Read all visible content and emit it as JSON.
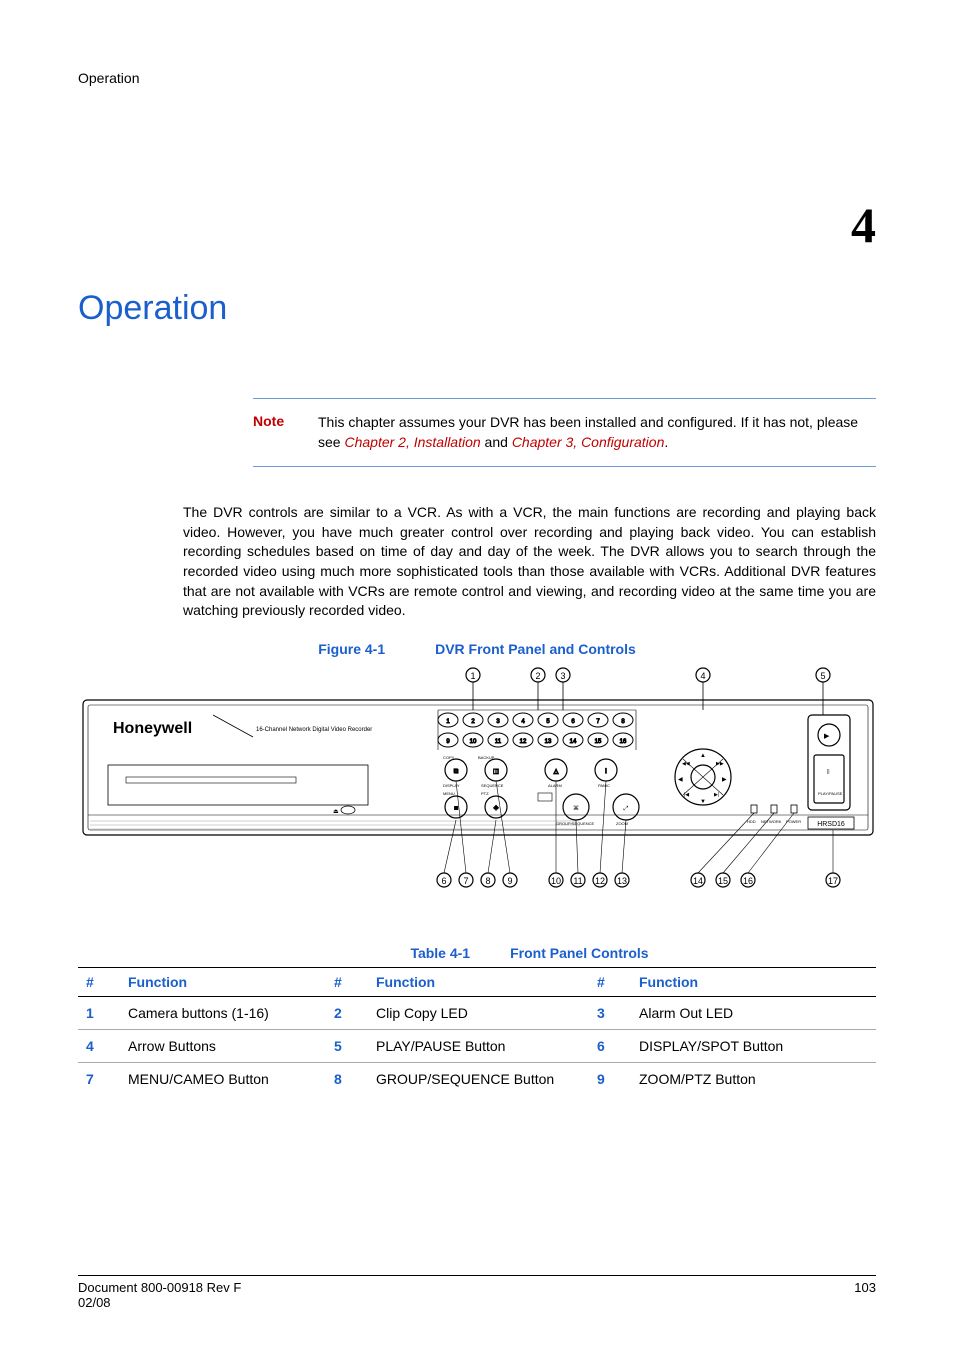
{
  "header_text": "Operation",
  "chapter_number": "4",
  "chapter_title": "Operation",
  "note": {
    "label": "Note",
    "before": "This chapter assumes your DVR has been installed and configured. If it has not, please see ",
    "link1": "Chapter 2, Installation",
    "mid": " and ",
    "link2": "Chapter 3, Configuration",
    "after": "."
  },
  "body_para": "The DVR controls are similar to a VCR. As with a VCR, the main functions are recording and playing back video. However, you have much greater control over recording and playing back video. You can establish recording schedules based on time of day and day of the week. The DVR allows you to search through the recorded video using much more sophisticated tools than those available with VCRs. Additional DVR features that are not available with VCRs are remote control and viewing, and recording video at the same time you are watching previously recorded video.",
  "figure": {
    "num": "Figure 4-1",
    "title": "DVR Front Panel and Controls",
    "brand": "Honeywell",
    "subtitle": "16-Channel Network Digital Video Recorder",
    "model_badge": "HRSD16",
    "panel_small_labels": [
      "COPY",
      "BACKUP",
      "DISPLAY",
      "SEQUENCE",
      "ALARM",
      "PANIC",
      "MENU",
      "PLAY/PAUSE",
      "PTZ",
      "ZOOM",
      "HDD",
      "NETWORK",
      "POWER"
    ]
  },
  "table": {
    "num": "Table 4-1",
    "title": "Front Panel Controls",
    "headers": [
      "#",
      "Function",
      "#",
      "Function",
      "#",
      "Function"
    ],
    "rows": [
      {
        "n1": "1",
        "f1": "Camera buttons (1-16)",
        "n2": "2",
        "f2": "Clip Copy LED",
        "n3": "3",
        "f3": "Alarm Out LED"
      },
      {
        "n1": "4",
        "f1": "Arrow Buttons",
        "n2": "5",
        "f2": "PLAY/PAUSE Button",
        "n3": "6",
        "f3": "DISPLAY/SPOT Button"
      },
      {
        "n1": "7",
        "f1": "MENU/CAMEO Button",
        "n2": "8",
        "f2": "GROUP/SEQUENCE Button",
        "n3": "9",
        "f3": "ZOOM/PTZ Button"
      }
    ]
  },
  "footer": {
    "left1": "Document 800-00918 Rev F",
    "left2": "02/08",
    "right": "103"
  }
}
